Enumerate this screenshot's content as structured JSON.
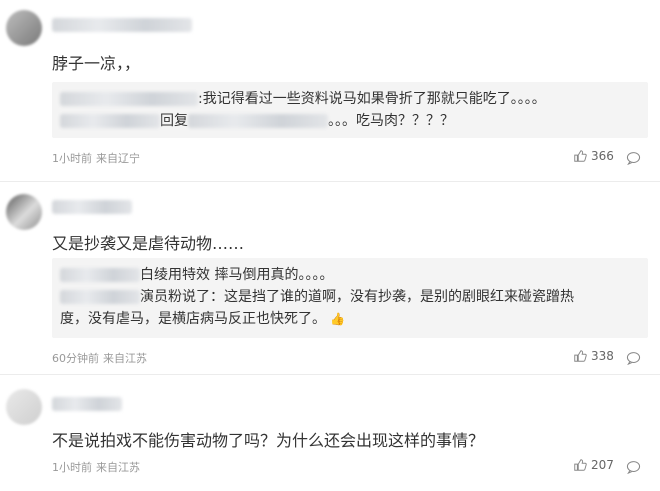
{
  "comments": [
    {
      "text": "脖子一凉，，",
      "quote_lines": [
        {
          "prefix": "",
          "text": ":我记得看过一些资料说马如果骨折了那就只能吃了。。。。"
        },
        {
          "prefix": "回复",
          "text": "。。。吃马肉？？？？"
        }
      ],
      "time": "1小时前",
      "location": "来自辽宁",
      "likes": "366"
    },
    {
      "text": "又是抄袭又是虐待动物……",
      "quote_lines": [
        {
          "prefix": "",
          "text": "白绫用特效 摔马倒用真的。。。。"
        },
        {
          "prefix": "",
          "text": "演员粉说了：这是挡了谁的道啊，没有抄袭，是别的剧眼红来碰瓷蹭热"
        },
        {
          "prefix": "",
          "text": "度，没有虐马，是横店病马反正也快死了。"
        }
      ],
      "time": "60分钟前",
      "location": "来自江苏",
      "likes": "338"
    },
    {
      "text": "不是说拍戏不能伤害动物了吗？为什么还会出现这样的事情？",
      "time": "1小时前",
      "location": "来自江苏",
      "likes": "207"
    }
  ],
  "icons": {
    "like": "thumbs-up-icon",
    "comment": "comment-bubble-icon",
    "emoji": "thumbs-up-emoji-icon"
  },
  "colors": {
    "meta": "#999999",
    "quote_bg": "#f4f4f4",
    "divider": "#ececec"
  }
}
